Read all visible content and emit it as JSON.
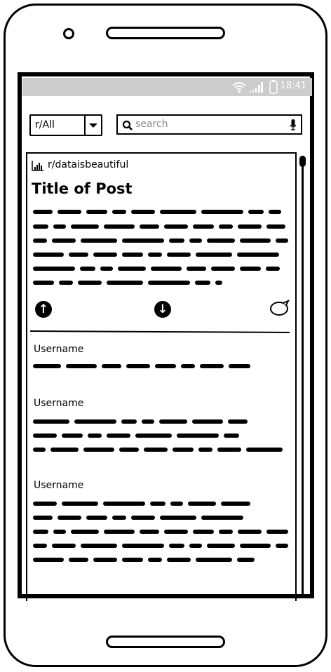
{
  "status_bar": {
    "time": "18:41",
    "icons": [
      "wifi-icon",
      "signal-icon",
      "battery-icon"
    ]
  },
  "toolbar": {
    "subreddit_select": "r/All",
    "search_placeholder": "search"
  },
  "post": {
    "subreddit": "r/dataisbeautiful",
    "subreddit_icon": "bar-chart-icon",
    "title": "Title of Post",
    "actions": [
      "upvote-icon",
      "downvote-icon",
      "comment-icon"
    ]
  },
  "comments": [
    {
      "username": "Username"
    },
    {
      "username": "Username"
    },
    {
      "username": "Username"
    }
  ]
}
